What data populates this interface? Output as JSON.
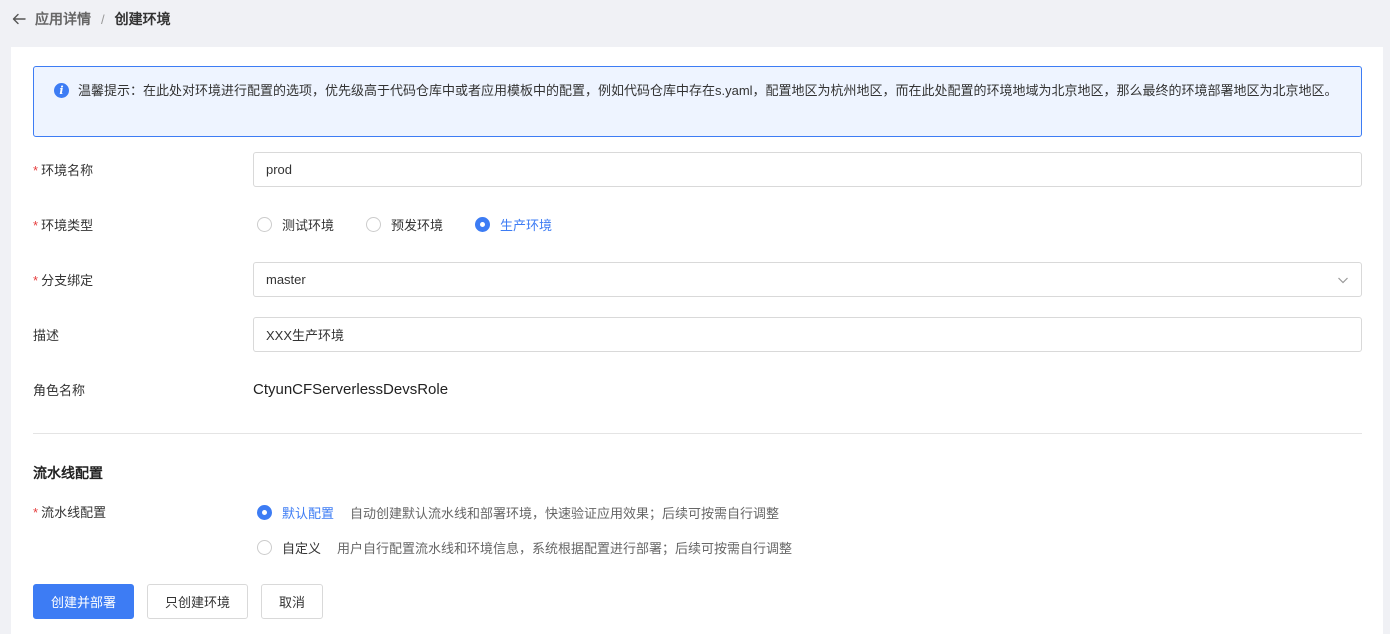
{
  "breadcrumb": {
    "parent": "应用详情",
    "separator": "/",
    "current": "创建环境"
  },
  "notice": {
    "icon": "info-icon",
    "text": "温馨提示：在此处对环境进行配置的选项，优先级高于代码仓库中或者应用模板中的配置，例如代码仓库中存在s.yaml，配置地区为杭州地区，而在此处配置的环境地域为北京地区，那么最终的环境部署地区为北京地区。"
  },
  "form": {
    "required_mark": "*",
    "env_name": {
      "label": "环境名称",
      "value": "prod"
    },
    "env_type": {
      "label": "环境类型",
      "options": [
        "测试环境",
        "预发环境",
        "生产环境"
      ],
      "selected": "生产环境"
    },
    "branch": {
      "label": "分支绑定",
      "value": "master"
    },
    "description": {
      "label": "描述",
      "value": "XXX生产环境"
    },
    "role": {
      "label": "角色名称",
      "value": "CtyunCFServerlessDevsRole"
    }
  },
  "pipeline": {
    "section_title": "流水线配置",
    "label": "流水线配置",
    "options": [
      {
        "name": "默认配置",
        "desc": "自动创建默认流水线和部署环境，快速验证应用效果；后续可按需自行调整",
        "selected": true
      },
      {
        "name": "自定义",
        "desc": "用户自行配置流水线和环境信息，系统根据配置进行部署；后续可按需自行调整",
        "selected": false
      }
    ]
  },
  "buttons": {
    "create_deploy": "创建并部署",
    "create_only": "只创建环境",
    "cancel": "取消"
  },
  "colors": {
    "primary": "#3d7cf4",
    "required": "#e63d3d",
    "notice_bg": "#eef4ff"
  }
}
